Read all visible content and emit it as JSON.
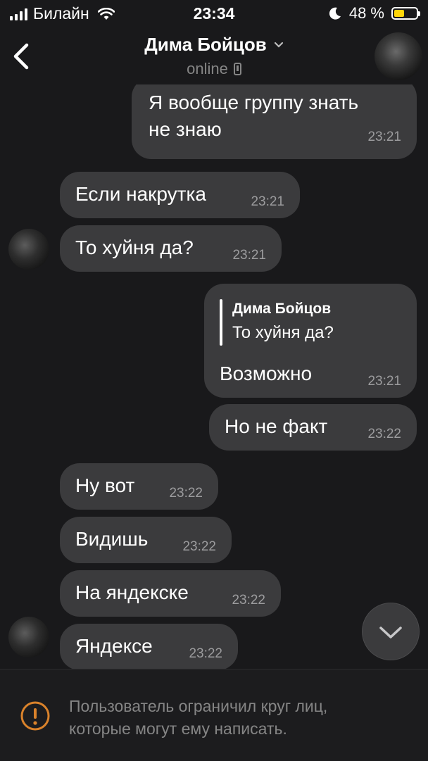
{
  "status_bar": {
    "carrier": "Билайн",
    "time": "23:34",
    "battery_percent": "48 %",
    "battery_level": 0.48,
    "signal_icon": "signal-icon",
    "wifi_icon": "wifi-icon",
    "moon_icon": "moon-icon",
    "battery_color": "#ffd60a"
  },
  "header": {
    "title": "Дима Бойцов",
    "subtitle": "online"
  },
  "messages": [
    {
      "text_lines": [
        "Я вообще группу знать",
        "не знаю"
      ],
      "time": "23:21",
      "outgoing": true
    },
    {
      "text": "Если накрутка",
      "time": "23:21",
      "outgoing": false
    },
    {
      "text": "То хуйня да?",
      "time": "23:21",
      "outgoing": false
    },
    {
      "quote_author": "Дима Бойцов",
      "quote_text": "То хуйня да?",
      "text": "Возможно",
      "time": "23:21",
      "outgoing": true
    },
    {
      "text": "Но не факт",
      "time": "23:22",
      "outgoing": true
    },
    {
      "text": "Ну вот",
      "time": "23:22",
      "outgoing": false
    },
    {
      "text": "Видишь",
      "time": "23:22",
      "outgoing": false
    },
    {
      "text": "На яндекске",
      "time": "23:22",
      "outgoing": false
    },
    {
      "text": "Яндексе",
      "time": "23:22",
      "outgoing": false
    }
  ],
  "footer": {
    "notice_lines": [
      "Пользователь ограничил круг лиц,",
      "которые могут ему написать."
    ]
  },
  "colors": {
    "background": "#19191b",
    "bubble": "#3b3b3d",
    "secondary_text": "#858585",
    "warning": "#d9822b"
  }
}
